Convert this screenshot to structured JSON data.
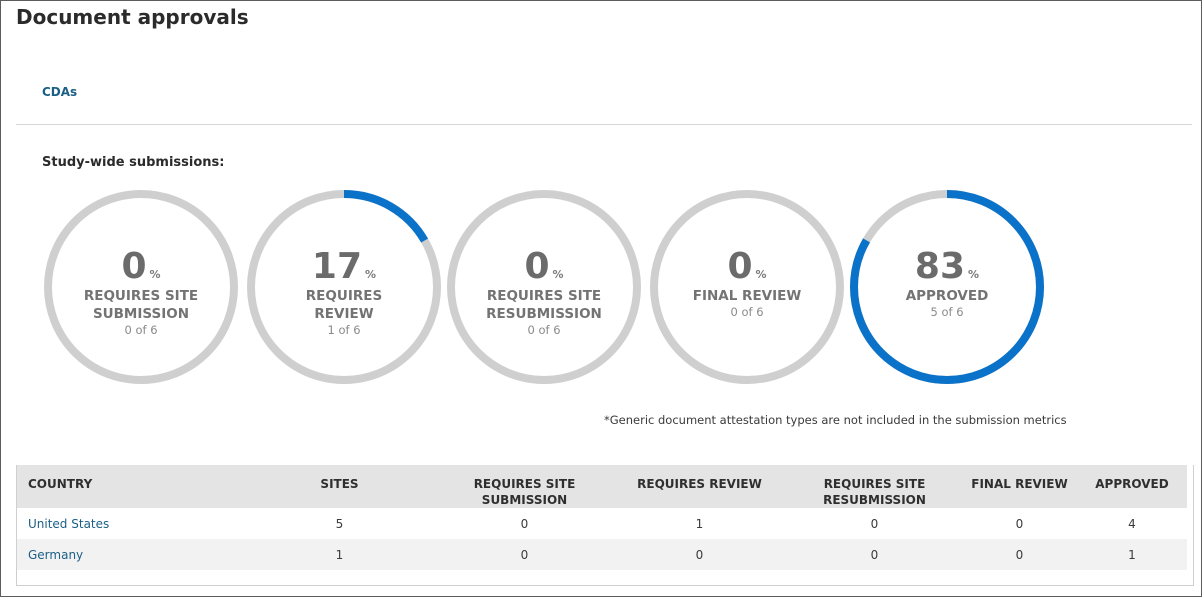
{
  "page": {
    "title": "Document approvals"
  },
  "tabs": [
    {
      "label": "CDAs"
    }
  ],
  "summary": {
    "heading": "Study-wide submissions:",
    "gauges": [
      {
        "label": "REQUIRES SITE SUBMISSION",
        "percent": 0,
        "count": "0 of 6",
        "fraction": 0
      },
      {
        "label": "REQUIRES REVIEW",
        "percent": 17,
        "count": "1 of 6",
        "fraction": 0.1667
      },
      {
        "label": "REQUIRES SITE RESUBMISSION",
        "percent": 0,
        "count": "0 of 6",
        "fraction": 0
      },
      {
        "label": "FINAL REVIEW",
        "percent": 0,
        "count": "0 of 6",
        "fraction": 0
      },
      {
        "label": "APPROVED",
        "percent": 83,
        "count": "5 of 6",
        "fraction": 0.8333
      }
    ],
    "percent_sign": "%",
    "footnote": "*Generic document attestation types are not included in the submission metrics"
  },
  "colors": {
    "track": "#cfcfcf",
    "progress": "#0a72c8",
    "link": "#1c5f86"
  },
  "table": {
    "headers": [
      "COUNTRY",
      "SITES",
      "REQUIRES SITE SUBMISSION",
      "REQUIRES REVIEW",
      "REQUIRES SITE RESUBMISSION",
      "FINAL REVIEW",
      "APPROVED"
    ],
    "rows": [
      [
        "United States",
        "5",
        "0",
        "1",
        "0",
        "0",
        "4"
      ],
      [
        "Germany",
        "1",
        "0",
        "0",
        "0",
        "0",
        "1"
      ]
    ]
  }
}
